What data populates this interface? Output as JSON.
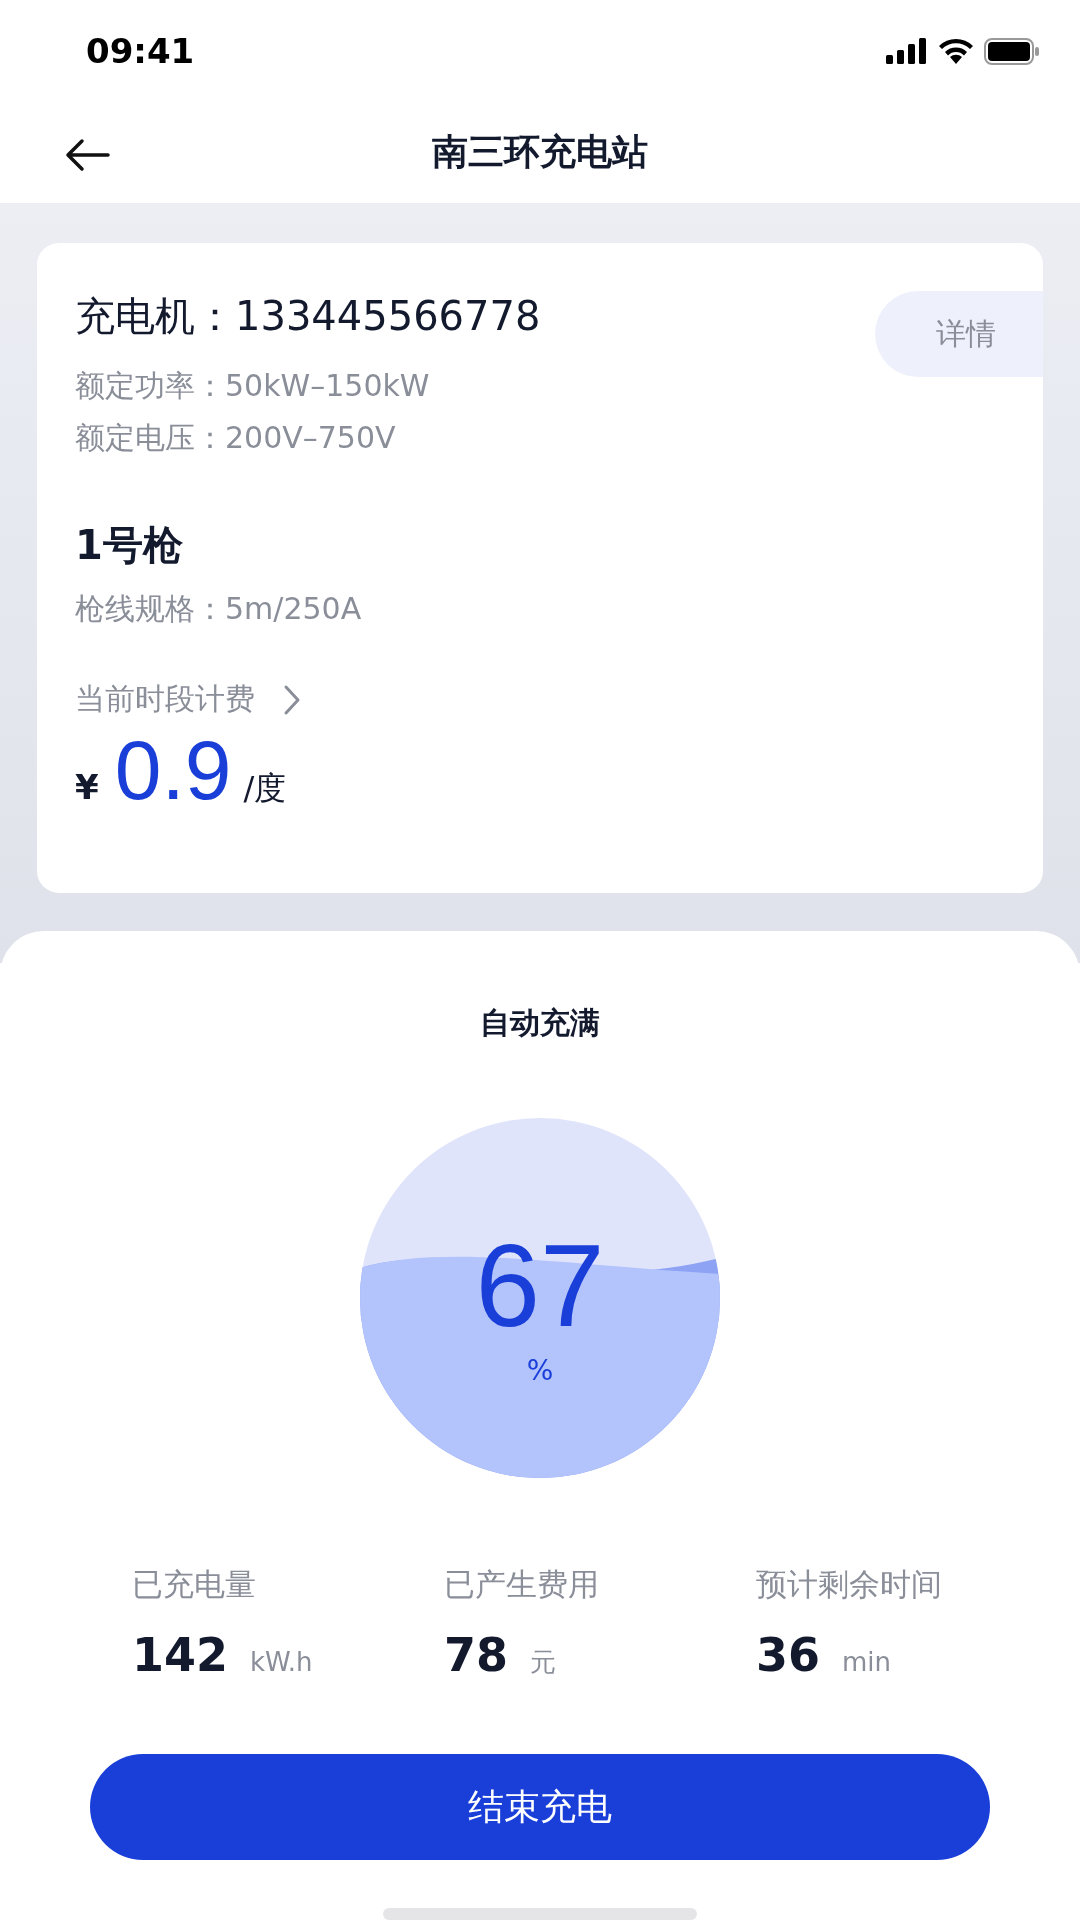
{
  "status_bar": {
    "time": "09:41"
  },
  "header": {
    "title": "南三环充电站"
  },
  "charger": {
    "title": "充电机：133445566778",
    "detail_button": "详情",
    "specs": [
      "额定功率：50kW–150kW",
      "额定电压：200V–750V"
    ]
  },
  "gun": {
    "title": "1号枪",
    "spec": "枪线规格：5m/250A"
  },
  "price": {
    "label": "当前时段计费",
    "currency": "¥",
    "value": "0.9",
    "unit": "/度"
  },
  "charging": {
    "mode": "自动充满",
    "percent": "67",
    "percent_sign": "%"
  },
  "stats": [
    {
      "label": "已充电量",
      "value": "142",
      "unit": "kW.h"
    },
    {
      "label": "已产生费用",
      "value": "78",
      "unit": "元"
    },
    {
      "label": "预计剩余时间",
      "value": "36",
      "unit": "min"
    }
  ],
  "stop_button": "结束充电"
}
